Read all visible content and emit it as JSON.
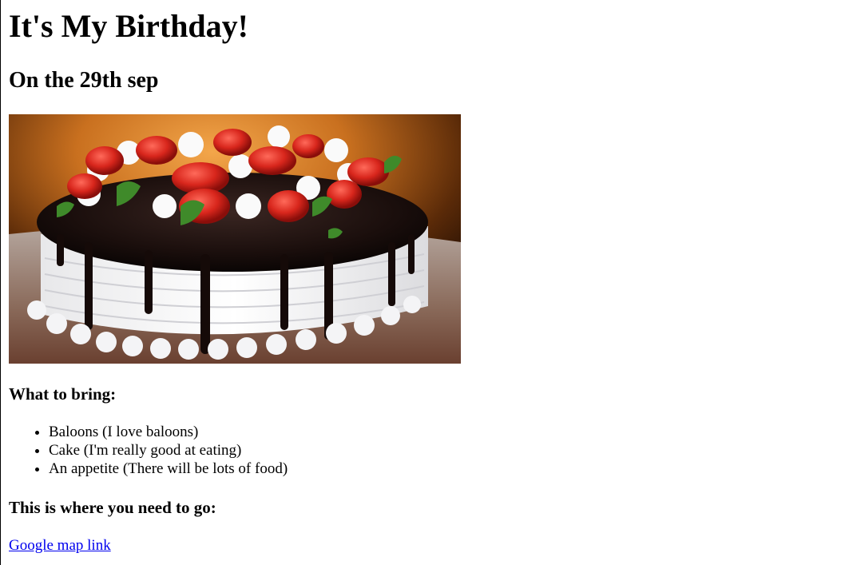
{
  "page": {
    "title": "It's My Birthday!",
    "subtitle": "On the 29th sep"
  },
  "bring": {
    "heading": "What to bring:",
    "items": [
      "Baloons (I love baloons)",
      "Cake (I'm really good at eating)",
      "An appetite (There will be lots of food)"
    ]
  },
  "directions": {
    "heading": "This is where you need to go:",
    "link_label": "Google map link"
  },
  "colors": {
    "link": "#0000ee",
    "text": "#000000"
  },
  "icons": {
    "image": "birthday-cake-image"
  }
}
